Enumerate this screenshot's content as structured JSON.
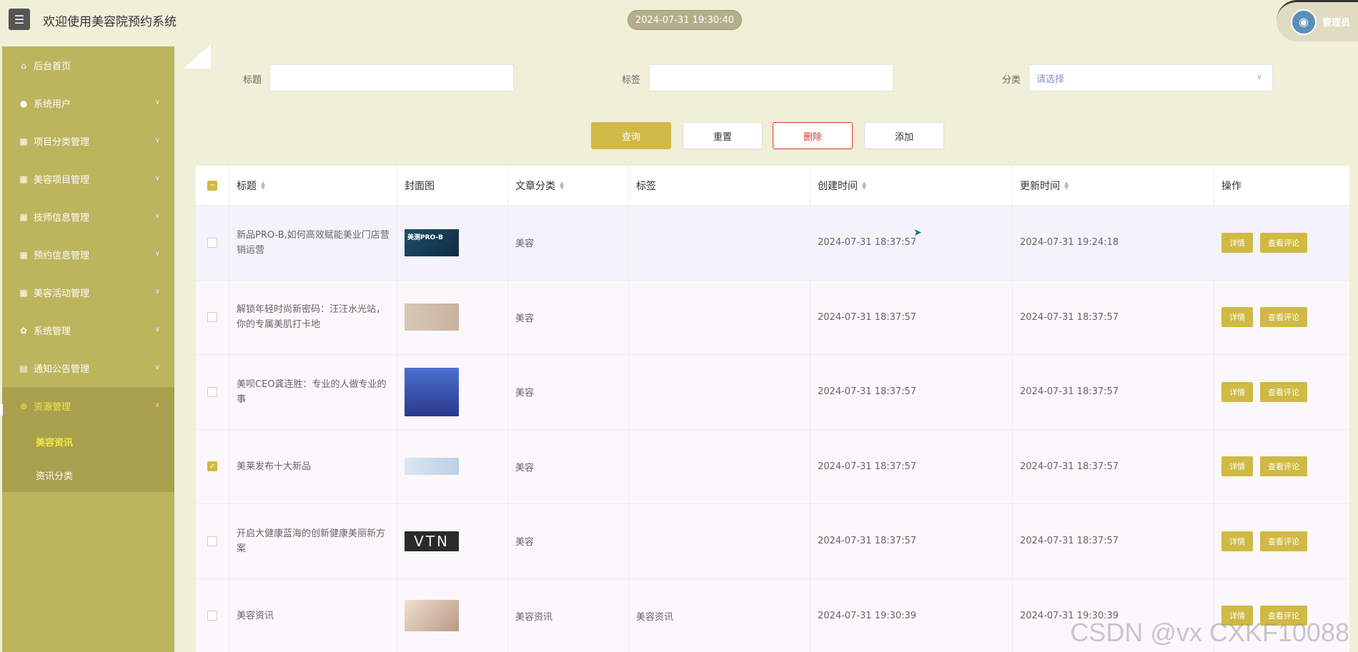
{
  "header": {
    "app_title": "欢迎使用美容院预约系统",
    "datetime": "2024-07-31 19:30:40",
    "user_label": "管理员"
  },
  "sidebar": {
    "items": [
      {
        "label": "后台首页",
        "icon": "home-icon",
        "expandable": false
      },
      {
        "label": "系统用户",
        "icon": "user-icon",
        "expandable": true
      },
      {
        "label": "项目分类管理",
        "icon": "grid-icon",
        "expandable": true
      },
      {
        "label": "美容项目管理",
        "icon": "grid-icon",
        "expandable": true
      },
      {
        "label": "技师信息管理",
        "icon": "grid-icon",
        "expandable": true
      },
      {
        "label": "预约信息管理",
        "icon": "grid-icon",
        "expandable": true
      },
      {
        "label": "美容活动管理",
        "icon": "grid-icon",
        "expandable": true
      },
      {
        "label": "系统管理",
        "icon": "gear-icon",
        "expandable": true
      },
      {
        "label": "通知公告管理",
        "icon": "document-icon",
        "expandable": true
      },
      {
        "label": "资源管理",
        "icon": "plus-circle-icon",
        "expandable": true,
        "expanded": true
      }
    ],
    "sub_items": [
      {
        "label": "美容资讯",
        "current": true
      },
      {
        "label": "资讯分类",
        "current": false
      }
    ]
  },
  "search": {
    "title_label": "标题",
    "tag_label": "标签",
    "category_label": "分类",
    "category_placeholder": "请选择"
  },
  "toolbar": {
    "query": "查询",
    "reset": "重置",
    "delete": "删除",
    "add": "添加"
  },
  "table": {
    "headers": [
      "标题",
      "封面图",
      "文章分类",
      "标签",
      "创建时间",
      "更新时间",
      "操作"
    ],
    "action_detail": "详情",
    "action_comment": "查看评论",
    "rows": [
      {
        "title": "新品PRO-B,如何高效赋能美业门店营销运营",
        "cover_text": "美测PRO-B",
        "category": "美容",
        "tag": "",
        "created": "2024-07-31 18:37:57",
        "updated": "2024-07-31 19:24:18",
        "checked": false
      },
      {
        "title": "解锁年轻时尚新密码：汪汪水光站，你的专属美肌打卡地",
        "cover_text": "",
        "category": "美容",
        "tag": "",
        "created": "2024-07-31 18:37:57",
        "updated": "2024-07-31 18:37:57",
        "checked": false
      },
      {
        "title": "美呗CEO龚连胜：专业的人做专业的事",
        "cover_text": "",
        "category": "美容",
        "tag": "",
        "created": "2024-07-31 18:37:57",
        "updated": "2024-07-31 18:37:57",
        "checked": false
      },
      {
        "title": "美莱发布十大新品",
        "cover_text": "",
        "category": "美容",
        "tag": "",
        "created": "2024-07-31 18:37:57",
        "updated": "2024-07-31 18:37:57",
        "checked": true
      },
      {
        "title": "开启大健康蓝海的创新健康美丽新方案",
        "cover_text": "VTN",
        "category": "美容",
        "tag": "",
        "created": "2024-07-31 18:37:57",
        "updated": "2024-07-31 18:37:57",
        "checked": false
      },
      {
        "title": "美容资讯",
        "cover_text": "",
        "category": "美容资讯",
        "tag": "美容资讯",
        "created": "2024-07-31 19:30:39",
        "updated": "2024-07-31 19:30:39",
        "checked": false
      }
    ]
  },
  "watermark": "CSDN @vx  CXKF10088",
  "colors": {
    "accent": "#d0b944",
    "sidebar": "#bdb45e",
    "background": "#f0efd8",
    "danger": "#dd3333"
  }
}
